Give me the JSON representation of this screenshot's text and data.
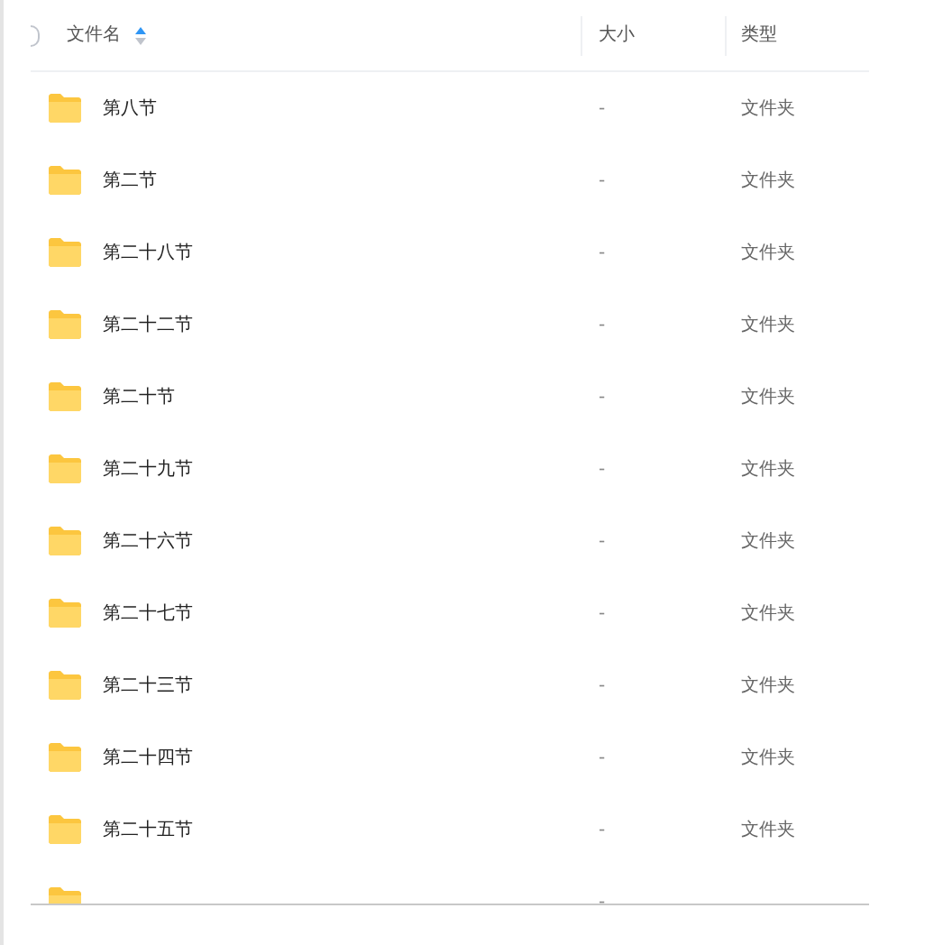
{
  "table": {
    "select_all": {
      "checked": false
    },
    "columns": [
      {
        "label": "文件名",
        "sort_ascending": true
      },
      {
        "label": "大小"
      },
      {
        "label": "类型"
      }
    ],
    "rows": [
      {
        "name": "第八节",
        "size": "-",
        "type": "文件夹"
      },
      {
        "name": "第二节",
        "size": "-",
        "type": "文件夹"
      },
      {
        "name": "第二十八节",
        "size": "-",
        "type": "文件夹"
      },
      {
        "name": "第二十二节",
        "size": "-",
        "type": "文件夹"
      },
      {
        "name": "第二十节",
        "size": "-",
        "type": "文件夹"
      },
      {
        "name": "第二十九节",
        "size": "-",
        "type": "文件夹"
      },
      {
        "name": "第二十六节",
        "size": "-",
        "type": "文件夹"
      },
      {
        "name": "第二十七节",
        "size": "-",
        "type": "文件夹"
      },
      {
        "name": "第二十三节",
        "size": "-",
        "type": "文件夹"
      },
      {
        "name": "第二十四节",
        "size": "-",
        "type": "文件夹"
      },
      {
        "name": "第二十五节",
        "size": "-",
        "type": "文件夹"
      },
      {
        "size": "-"
      }
    ]
  }
}
